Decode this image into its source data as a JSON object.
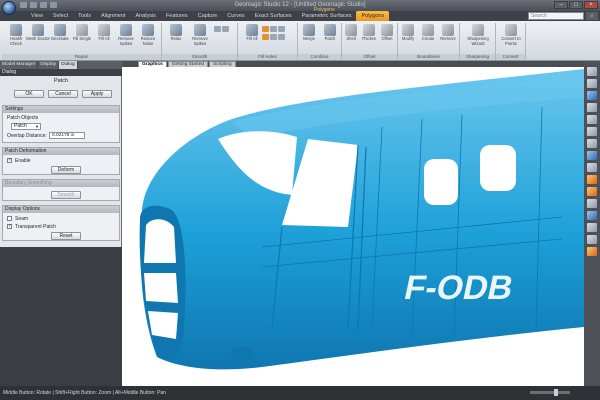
{
  "title_bar": {
    "title": "Geomagic Studio 12 - [Untitled Geomagic Studio]",
    "quick_access_icons": [
      "save-icon",
      "undo-icon",
      "redo-icon",
      "customize-icon"
    ],
    "window_buttons": [
      "minimize-icon",
      "restore-icon",
      "close-icon"
    ]
  },
  "menu": {
    "tabs": [
      "View",
      "Select",
      "Tools",
      "Alignment",
      "Analysis",
      "Features",
      "Capture",
      "Curves",
      "Exact Surfaces",
      "Parametric Surfaces",
      "Polygons"
    ],
    "active_tab": "Polygons",
    "context_label": "Polygons",
    "search_placeholder": "Search",
    "search_icon": "search-icon"
  },
  "ribbon": {
    "groups": [
      {
        "label": "Repair",
        "buttons": [
          "Health Check",
          "Mesh Doctor",
          "Decimate",
          "Fill Single",
          "Fill All",
          "Remove Spikes",
          "Reduce Noise"
        ]
      },
      {
        "label": "Smooth",
        "buttons": [
          "Relax",
          "Remove Spikes"
        ]
      },
      {
        "label": "Fill Holes",
        "buttons": [
          "Fill All",
          "Fill Single"
        ]
      },
      {
        "label": "Combine",
        "buttons": [
          "Merge",
          "Patch"
        ]
      },
      {
        "label": "Offset",
        "buttons": [
          "Shell",
          "Thicken",
          "Offset"
        ]
      },
      {
        "label": "Boundaries",
        "buttons": [
          "Modify",
          "Create",
          "Remove"
        ]
      },
      {
        "label": "Sharpening",
        "buttons": [
          "Sharpening Wizard"
        ]
      },
      {
        "label": "Convert",
        "buttons": [
          "Convert to Points"
        ]
      }
    ]
  },
  "left_panel": {
    "tabs": [
      "Model Manager",
      "Display",
      "Dialog"
    ],
    "active_tab": "Dialog",
    "header": "Dialog",
    "pane_title": "Patch",
    "buttons": {
      "ok": "OK",
      "cancel": "Cancel",
      "apply": "Apply"
    },
    "settings": {
      "title": "Settings",
      "patch_objects_label": "Patch Objects",
      "patch_objects_value": "Patch",
      "overlap_distance_label": "Overlap Distance:",
      "overlap_distance_value": "0.02179 in"
    },
    "patch_deformation": {
      "title": "Patch Deformation",
      "enable_label": "Enable",
      "enable_checked": true,
      "deform_button": "Deform"
    },
    "boundary_smoothing": {
      "title": "Boundary Smoothing",
      "smooth_button": "Smooth"
    },
    "display_options": {
      "title": "Display Options",
      "seam_label": "Seam",
      "seam_checked": false,
      "transparent_label": "Transparent Patch",
      "transparent_checked": true,
      "reset_button": "Reset"
    }
  },
  "document_tabs": [
    "Graphics",
    "Getting Started",
    "Scripting"
  ],
  "active_document_tab": "Graphics",
  "viewport": {
    "model_color": "#1da0d8",
    "shade_color": "#0f76b0",
    "highlight_color": "#6cc7ee",
    "registration_text": "F-ODB"
  },
  "right_toolbar": {
    "icons": [
      "arrow-icon",
      "select-icon",
      "lasso-icon",
      "brush-icon",
      "zoom-icon",
      "pan-icon",
      "rotate-icon",
      "view-icon",
      "fit-icon",
      "orange-mesh-icon",
      "orange-tool-icon",
      "light-icon",
      "display-icon",
      "ruler-icon",
      "grid-icon",
      "orange-shade-icon"
    ]
  },
  "status_bar": {
    "text": "Middle Button: Rotate | Shift+Right Button: Zoom | Alt+Middle Button: Pan"
  },
  "colors": {
    "accent": "#e8962a",
    "panel_dark": "#3a3d43",
    "ribbon_bg": "#dde1e7"
  }
}
